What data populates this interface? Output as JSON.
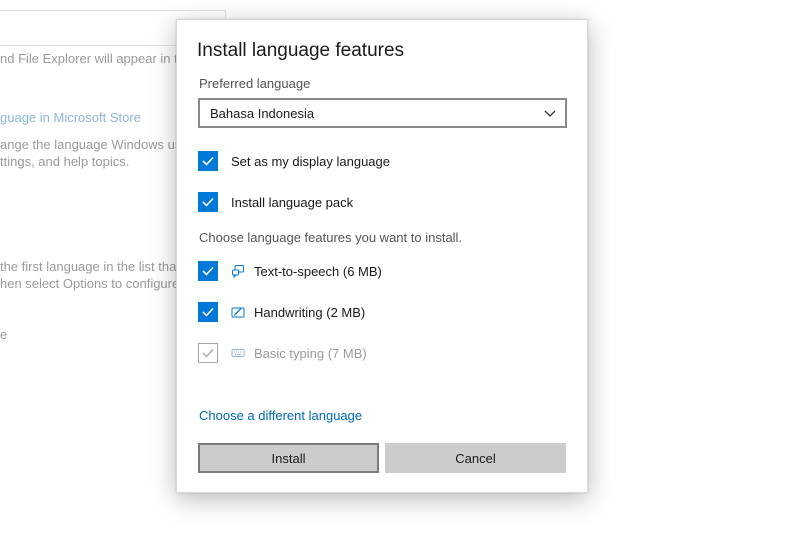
{
  "background": {
    "lines": [
      "nd File Explorer will appear in th",
      "guage in Microsoft Store",
      "ange the language Windows us",
      "ttings, and help topics.",
      "the first language in the list tha",
      "hen select Options to configure",
      "e"
    ]
  },
  "dialog": {
    "title": "Install language features",
    "preferred_label": "Preferred language",
    "selected_language": "Bahasa Indonesia",
    "options": [
      {
        "label": "Set as my display language",
        "checked": true
      },
      {
        "label": "Install language pack",
        "checked": true
      }
    ],
    "features_hint": "Choose language features you want to install.",
    "features": [
      {
        "label": "Text-to-speech (6 MB)",
        "icon": "speech-icon",
        "checked": true,
        "enabled": true
      },
      {
        "label": "Handwriting (2 MB)",
        "icon": "pen-icon",
        "checked": true,
        "enabled": true
      },
      {
        "label": "Basic typing (7 MB)",
        "icon": "keyboard-icon",
        "checked": true,
        "enabled": false
      }
    ],
    "different_language_link": "Choose a different language",
    "install_label": "Install",
    "cancel_label": "Cancel"
  },
  "colors": {
    "accent": "#0078d7",
    "link": "#0067b8",
    "button": "#cccccc"
  }
}
